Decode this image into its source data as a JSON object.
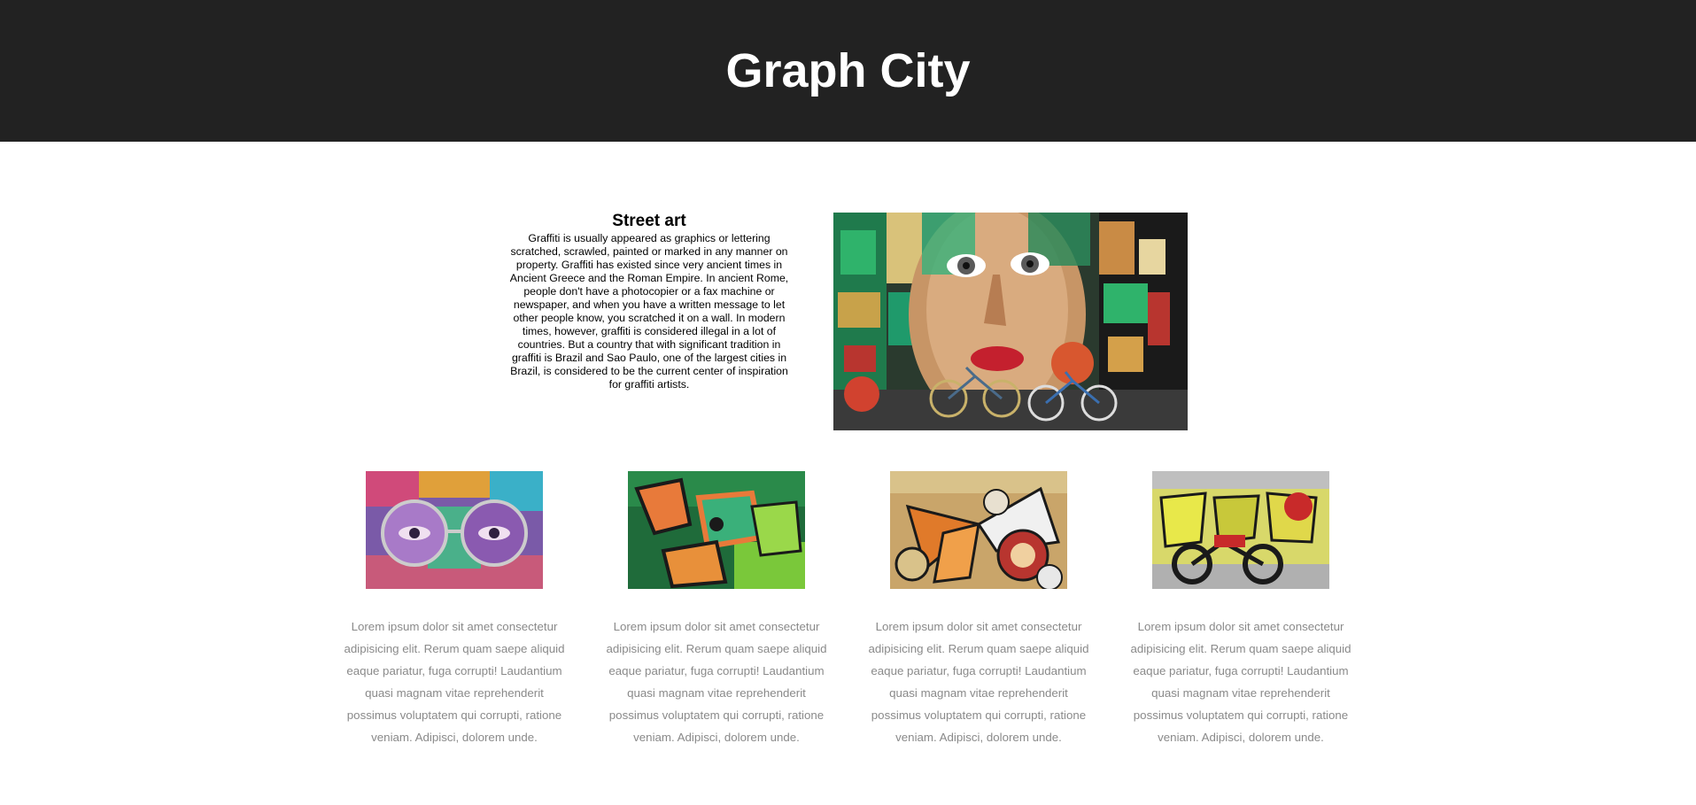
{
  "header": {
    "title": "Graph City"
  },
  "intro": {
    "heading": "Street art",
    "body": "Graffiti is usually appeared as graphics or lettering scratched, scrawled, painted or marked in any manner on property. Graffiti has existed since very ancient times in Ancient Greece and the Roman Empire. In ancient Rome, people don't have a photocopier or a fax machine or newspaper, and when you have a written message to let other people know, you scratched it on a wall. In modern times, however, graffiti is considered illegal in a lot of countries. But a country that with significant tradition in graffiti is Brazil and Sao Paulo, one of the largest cities in Brazil, is considered to be the current center of inspiration for graffiti artists."
  },
  "hero_image": {
    "alt": "Mural of a woman's face with bicycles parked in front"
  },
  "cards": [
    {
      "image_alt": "Colorful mural of a face wearing round glasses",
      "text": "Lorem ipsum dolor sit amet consectetur adipisicing elit. Rerum quam saepe aliquid eaque pariatur, fuga corrupti! Laudantium quasi magnam vitae reprehenderit possimus voluptatem qui corrupti, ratione veniam. Adipisci, dolorem unde."
    },
    {
      "image_alt": "Green and orange graffiti lettering",
      "text": "Lorem ipsum dolor sit amet consectetur adipisicing elit. Rerum quam saepe aliquid eaque pariatur, fuga corrupti! Laudantium quasi magnam vitae reprehenderit possimus voluptatem qui corrupti, ratione veniam. Adipisci, dolorem unde."
    },
    {
      "image_alt": "Graffiti of a butterfly and owl",
      "text": "Lorem ipsum dolor sit amet consectetur adipisicing elit. Rerum quam saepe aliquid eaque pariatur, fuga corrupti! Laudantium quasi magnam vitae reprehenderit possimus voluptatem qui corrupti, ratione veniam. Adipisci, dolorem unde."
    },
    {
      "image_alt": "Motorcycle in front of a graffiti wall",
      "text": "Lorem ipsum dolor sit amet consectetur adipisicing elit. Rerum quam saepe aliquid eaque pariatur, fuga corrupti! Laudantium quasi magnam vitae reprehenderit possimus voluptatem qui corrupti, ratione veniam. Adipisci, dolorem unde."
    }
  ],
  "colors": {
    "header_bg": "#222222",
    "header_text": "#ffffff",
    "card_text": "#8a8a8a"
  }
}
